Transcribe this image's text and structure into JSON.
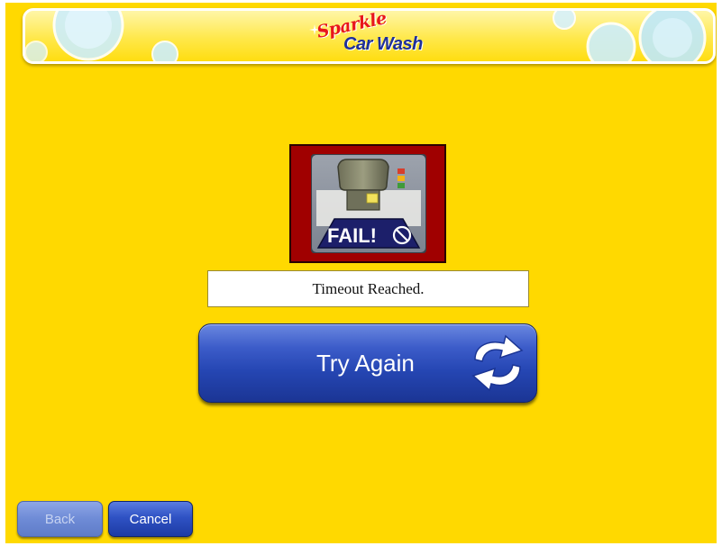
{
  "header": {
    "logo_script": "Sparkle",
    "logo_main": "Car Wash"
  },
  "status": {
    "icon_label": "FAIL!",
    "message": "Timeout Reached."
  },
  "actions": {
    "try_again_label": "Try Again"
  },
  "nav": {
    "back_label": "Back",
    "back_enabled": false,
    "cancel_label": "Cancel"
  },
  "colors": {
    "background": "#ffd900",
    "button_blue": "#2546b3",
    "frame_red": "#a00000",
    "logo_red": "#e8161b",
    "logo_blue": "#1e2f9a"
  },
  "icons": {
    "fail": "fail-icon",
    "prohibited": "prohibited-icon",
    "refresh": "refresh-icon",
    "sparkle": "sparkle-icon"
  }
}
